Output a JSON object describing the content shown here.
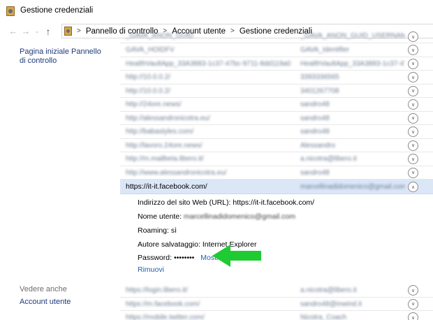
{
  "window": {
    "title": "Gestione credenziali"
  },
  "address_bar": {
    "crumbs": [
      "Pannello di controllo",
      "Account utente",
      "Gestione credenziali"
    ]
  },
  "sidebar": {
    "home_link": "Pagina iniziale Pannello di controllo",
    "see_also": "Vedere anche",
    "account_link": "Account utente"
  },
  "credentials_top": [
    {
      "url": "_GAVA_ANON_GUID",
      "user": "_GAVA_ANON_GUID_USERNAME"
    },
    {
      "url": "GAVA_HOIDFV",
      "user": "GAVA_Identifier"
    },
    {
      "url": "HealthVaultApp_33A3883-1c37-47bc-9711-8dd119a0",
      "user": "HealthVaultApp_33A3883-1c37-47..."
    },
    {
      "url": "http://10.0.0.2/",
      "user": "3393336565"
    },
    {
      "url": "http://10.0.0.2/",
      "user": "3401267708"
    },
    {
      "url": "http://24ore.news/",
      "user": "sandro48"
    },
    {
      "url": "http://alessandronicotra.eu/",
      "user": "sandro48"
    },
    {
      "url": "http://babastyles.com/",
      "user": "sandro48"
    },
    {
      "url": "http://lavoro.24ore.news/",
      "user": "Alessandro"
    },
    {
      "url": "http://m.mailbeta.libero.it/",
      "user": "a.nicotra@libero.it"
    },
    {
      "url": "http://www.alessandronicotra.eu/",
      "user": "sandro48"
    }
  ],
  "selected": {
    "url": "https://it-it.facebook.com/",
    "user": "marcellinadidomenico@gmail.com",
    "details": {
      "site_label": "Indirizzo del sito Web (URL):",
      "site_value": "https://it-it.facebook.com/",
      "user_label": "Nome utente:",
      "user_value": "marcellinadidomenico@gmail.com",
      "roaming_label": "Roaming:",
      "roaming_value": "sì",
      "author_label": "Autore salvataggio:",
      "author_value": "Internet Explorer",
      "password_label": "Password:",
      "password_value": "••••••••",
      "show_link": "Mostra",
      "remove_link": "Rimuovi"
    }
  },
  "credentials_bottom": [
    {
      "url": "https://login.libero.it/",
      "user": "a.nicotra@libero.it"
    },
    {
      "url": "https://m.facebook.com/",
      "user": "sandro48@inwind.it"
    },
    {
      "url": "https://mobile.twitter.com/",
      "user": "Nicotra_Coach"
    }
  ],
  "colors": {
    "selected_row": "#dbe7f7",
    "link": "#1e5fb4",
    "arrow": "#1ecb33"
  }
}
